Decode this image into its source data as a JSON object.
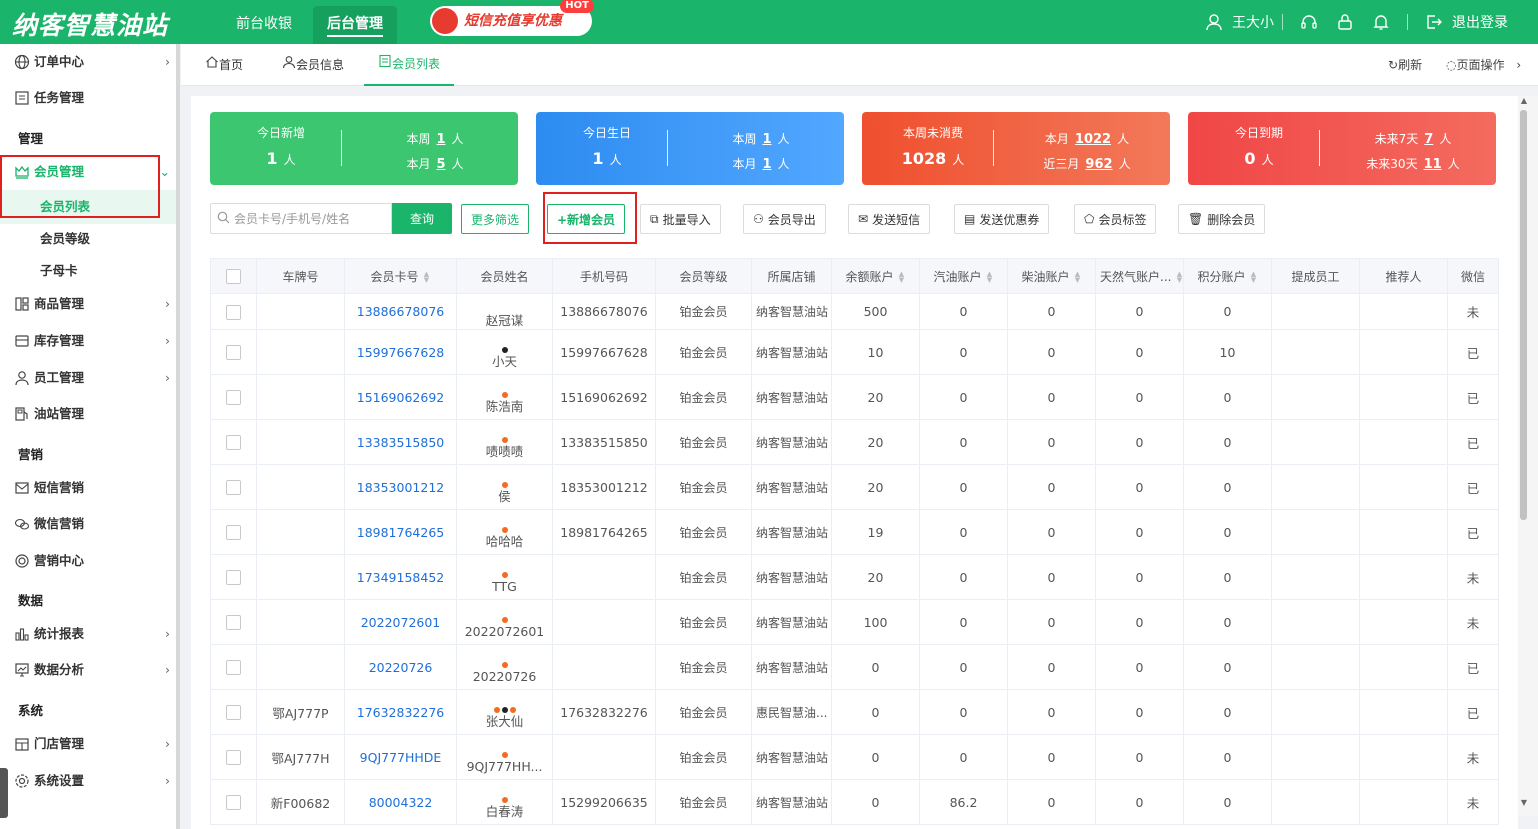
{
  "header": {
    "logo": "纳客智慧油站",
    "tabs": [
      "前台收银",
      "后台管理"
    ],
    "promo": "短信充值享优惠",
    "promo_badge": "HOT",
    "user": "王大小",
    "logout": "退出登录"
  },
  "sidebar": {
    "items": {
      "order": "订单中心",
      "task": "任务管理",
      "group_manage": "管理",
      "member": "会员管理",
      "member_list": "会员列表",
      "member_level": "会员等级",
      "sub_card": "子母卡",
      "goods": "商品管理",
      "stock": "库存管理",
      "staff": "员工管理",
      "station": "油站管理",
      "group_marketing": "营销",
      "sms": "短信营销",
      "wechat": "微信营销",
      "mkt_center": "营销中心",
      "group_data": "数据",
      "report": "统计报表",
      "analysis": "数据分析",
      "group_system": "系统",
      "store": "门店管理",
      "settings": "系统设置"
    }
  },
  "breadcrumb": {
    "home": "首页",
    "info": "会员信息",
    "list": "会员列表",
    "refresh": "刷新",
    "page_ops": "页面操作"
  },
  "stats": [
    {
      "label": "今日新增",
      "value": "1",
      "unit": "人",
      "r1_label": "本周",
      "r1_value": "1",
      "r2_label": "本月",
      "r2_value": "5",
      "r_unit": "人"
    },
    {
      "label": "今日生日",
      "value": "1",
      "unit": "人",
      "r1_label": "本周",
      "r1_value": "1",
      "r2_label": "本月",
      "r2_value": "1",
      "r_unit": "人"
    },
    {
      "label": "本周未消费",
      "value": "1028",
      "unit": "人",
      "r1_label": "本月",
      "r1_value": "1022",
      "r2_label": "近三月",
      "r2_value": "962",
      "r_unit": "人"
    },
    {
      "label": "今日到期",
      "value": "0",
      "unit": "人",
      "r1_label": "未来7天",
      "r1_value": "7",
      "r2_label": "未来30天",
      "r2_value": "11",
      "r_unit": "人"
    }
  ],
  "toolbar": {
    "search_placeholder": "会员卡号/手机号/姓名",
    "query": "查询",
    "more_filter": "更多筛选",
    "add_member": "+新增会员",
    "batch_import": "批量导入",
    "export": "会员导出",
    "send_sms": "发送短信",
    "send_coupon": "发送优惠券",
    "tag": "会员标签",
    "delete": "删除会员"
  },
  "table": {
    "headers": [
      "车牌号",
      "会员卡号",
      "会员姓名",
      "手机号码",
      "会员等级",
      "所属店铺",
      "余额账户",
      "汽油账户",
      "柴油账户",
      "天然气账户...",
      "积分账户",
      "提成员工",
      "推荐人",
      "微信"
    ],
    "rows": [
      {
        "plate": "",
        "card": "13886678076",
        "name": "赵冠谋",
        "dots": [],
        "phone": "13886678076",
        "level": "铂金会员",
        "store": "纳客智慧油站",
        "balance": "500",
        "gas": "0",
        "diesel": "0",
        "ng": "0",
        "points": "0",
        "staff": "",
        "ref": "",
        "wx": "未"
      },
      {
        "plate": "",
        "card": "15997667628",
        "name": "小天",
        "dots": [
          "#222"
        ],
        "phone": "15997667628",
        "level": "铂金会员",
        "store": "纳客智慧油站",
        "balance": "10",
        "gas": "0",
        "diesel": "0",
        "ng": "0",
        "points": "10",
        "staff": "",
        "ref": "",
        "wx": "已"
      },
      {
        "plate": "",
        "card": "15169062692",
        "name": "陈浩南",
        "dots": [
          "#f56a1f"
        ],
        "phone": "15169062692",
        "level": "铂金会员",
        "store": "纳客智慧油站",
        "balance": "20",
        "gas": "0",
        "diesel": "0",
        "ng": "0",
        "points": "0",
        "staff": "",
        "ref": "",
        "wx": "已"
      },
      {
        "plate": "",
        "card": "13383515850",
        "name": "啧啧啧",
        "dots": [
          "#f56a1f"
        ],
        "phone": "13383515850",
        "level": "铂金会员",
        "store": "纳客智慧油站",
        "balance": "20",
        "gas": "0",
        "diesel": "0",
        "ng": "0",
        "points": "0",
        "staff": "",
        "ref": "",
        "wx": "已"
      },
      {
        "plate": "",
        "card": "18353001212",
        "name": "侯",
        "dots": [
          "#f56a1f"
        ],
        "phone": "18353001212",
        "level": "铂金会员",
        "store": "纳客智慧油站",
        "balance": "20",
        "gas": "0",
        "diesel": "0",
        "ng": "0",
        "points": "0",
        "staff": "",
        "ref": "",
        "wx": "已"
      },
      {
        "plate": "",
        "card": "18981764265",
        "name": "哈哈哈",
        "dots": [
          "#f56a1f"
        ],
        "phone": "18981764265",
        "level": "铂金会员",
        "store": "纳客智慧油站",
        "balance": "19",
        "gas": "0",
        "diesel": "0",
        "ng": "0",
        "points": "0",
        "staff": "",
        "ref": "",
        "wx": "已"
      },
      {
        "plate": "",
        "card": "17349158452",
        "name": "TTG",
        "dots": [
          "#f56a1f"
        ],
        "phone": "",
        "level": "铂金会员",
        "store": "纳客智慧油站",
        "balance": "20",
        "gas": "0",
        "diesel": "0",
        "ng": "0",
        "points": "0",
        "staff": "",
        "ref": "",
        "wx": "未"
      },
      {
        "plate": "",
        "card": "2022072601",
        "name": "2022072601",
        "dots": [
          "#f56a1f"
        ],
        "phone": "",
        "level": "铂金会员",
        "store": "纳客智慧油站",
        "balance": "100",
        "gas": "0",
        "diesel": "0",
        "ng": "0",
        "points": "0",
        "staff": "",
        "ref": "",
        "wx": "未"
      },
      {
        "plate": "",
        "card": "20220726",
        "name": "20220726",
        "dots": [
          "#f56a1f"
        ],
        "phone": "",
        "level": "铂金会员",
        "store": "纳客智慧油站",
        "balance": "0",
        "gas": "0",
        "diesel": "0",
        "ng": "0",
        "points": "0",
        "staff": "",
        "ref": "",
        "wx": "已"
      },
      {
        "plate": "鄂AJ777P",
        "card": "17632832276",
        "name": "张大仙",
        "dots": [
          "#f56a1f",
          "#222",
          "#f56a1f"
        ],
        "phone": "17632832276",
        "level": "铂金会员",
        "store": "惠民智慧油...",
        "balance": "0",
        "gas": "0",
        "diesel": "0",
        "ng": "0",
        "points": "0",
        "staff": "",
        "ref": "",
        "wx": "已"
      },
      {
        "plate": "鄂AJ777H",
        "card": "9QJ777HHDE",
        "name": "9QJ777HH...",
        "dots": [
          "#f56a1f"
        ],
        "phone": "",
        "level": "铂金会员",
        "store": "纳客智慧油站",
        "balance": "0",
        "gas": "0",
        "diesel": "0",
        "ng": "0",
        "points": "0",
        "staff": "",
        "ref": "",
        "wx": "未"
      },
      {
        "plate": "新F00682",
        "card": "80004322",
        "name": "白春涛",
        "dots": [
          "#f56a1f"
        ],
        "phone": "15299206635",
        "level": "铂金会员",
        "store": "纳客智慧油站",
        "balance": "0",
        "gas": "86.2",
        "diesel": "0",
        "ng": "0",
        "points": "0",
        "staff": "",
        "ref": "",
        "wx": "未"
      }
    ]
  },
  "colors": {
    "brand": "#1ab56b",
    "link": "#1e6fd9",
    "highlight_box": "#e02020"
  }
}
